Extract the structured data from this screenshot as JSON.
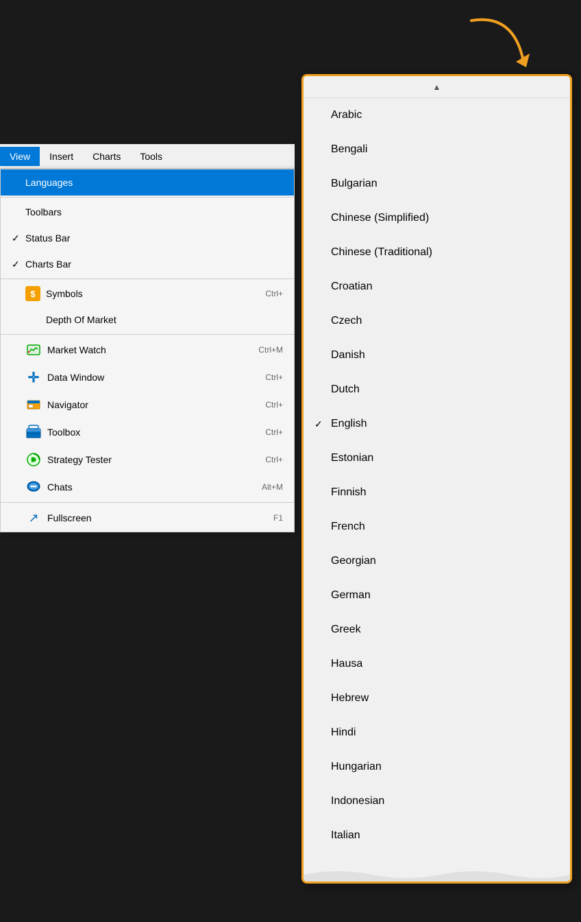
{
  "arrow": {
    "color": "#f0a020"
  },
  "menubar": {
    "items": [
      {
        "id": "view",
        "label": "View",
        "active": true
      },
      {
        "id": "insert",
        "label": "Insert",
        "active": false
      },
      {
        "id": "charts",
        "label": "Charts",
        "active": false
      },
      {
        "id": "tools",
        "label": "Tools",
        "active": false
      }
    ]
  },
  "dropdown": {
    "items": [
      {
        "id": "languages",
        "label": "Languages",
        "highlighted": true,
        "check": "",
        "icon": null,
        "shortcut": "",
        "hasIcon": false
      },
      {
        "id": "toolbars",
        "label": "Toolbars",
        "check": "",
        "icon": null,
        "shortcut": "",
        "hasIcon": false
      },
      {
        "id": "status-bar",
        "label": "Status Bar",
        "check": "✓",
        "icon": null,
        "shortcut": "",
        "hasIcon": false
      },
      {
        "id": "charts-bar",
        "label": "Charts Bar",
        "check": "✓",
        "icon": null,
        "shortcut": "",
        "hasIcon": false
      },
      {
        "id": "symbols",
        "label": "Symbols",
        "check": "",
        "icon": "$",
        "shortcut": "Ctrl+",
        "hasIcon": true,
        "iconType": "symbols"
      },
      {
        "id": "depth-of-market",
        "label": "Depth Of Market",
        "check": "",
        "icon": null,
        "shortcut": "",
        "hasIcon": false
      },
      {
        "id": "market-watch",
        "label": "Market Watch",
        "check": "",
        "icon": "📈",
        "shortcut": "Ctrl+M",
        "hasIcon": true,
        "iconType": "market-watch"
      },
      {
        "id": "data-window",
        "label": "Data Window",
        "check": "",
        "icon": "+",
        "shortcut": "Ctrl+",
        "hasIcon": true,
        "iconType": "data-window"
      },
      {
        "id": "navigator",
        "label": "Navigator",
        "check": "",
        "icon": "📁",
        "shortcut": "Ctrl+",
        "hasIcon": true,
        "iconType": "navigator"
      },
      {
        "id": "toolbox",
        "label": "Toolbox",
        "check": "",
        "icon": "🗃",
        "shortcut": "Ctrl+",
        "hasIcon": true,
        "iconType": "toolbox"
      },
      {
        "id": "strategy-tester",
        "label": "Strategy Tester",
        "check": "",
        "icon": "⚙",
        "shortcut": "Ctrl+",
        "hasIcon": true,
        "iconType": "strategy"
      },
      {
        "id": "chats",
        "label": "Chats",
        "check": "",
        "icon": "💬",
        "shortcut": "Alt+M",
        "hasIcon": true,
        "iconType": "chats"
      },
      {
        "id": "fullscreen",
        "label": "Fullscreen",
        "check": "",
        "icon": "↗",
        "shortcut": "F1",
        "hasIcon": true,
        "iconType": "fullscreen"
      }
    ]
  },
  "languages": {
    "scroll_up_label": "▲",
    "items": [
      {
        "id": "arabic",
        "label": "Arabic",
        "selected": false
      },
      {
        "id": "bengali",
        "label": "Bengali",
        "selected": false
      },
      {
        "id": "bulgarian",
        "label": "Bulgarian",
        "selected": false
      },
      {
        "id": "chinese-simplified",
        "label": "Chinese (Simplified)",
        "selected": false
      },
      {
        "id": "chinese-traditional",
        "label": "Chinese (Traditional)",
        "selected": false
      },
      {
        "id": "croatian",
        "label": "Croatian",
        "selected": false
      },
      {
        "id": "czech",
        "label": "Czech",
        "selected": false
      },
      {
        "id": "danish",
        "label": "Danish",
        "selected": false
      },
      {
        "id": "dutch",
        "label": "Dutch",
        "selected": false
      },
      {
        "id": "english",
        "label": "English",
        "selected": true
      },
      {
        "id": "estonian",
        "label": "Estonian",
        "selected": false
      },
      {
        "id": "finnish",
        "label": "Finnish",
        "selected": false
      },
      {
        "id": "french",
        "label": "French",
        "selected": false
      },
      {
        "id": "georgian",
        "label": "Georgian",
        "selected": false
      },
      {
        "id": "german",
        "label": "German",
        "selected": false
      },
      {
        "id": "greek",
        "label": "Greek",
        "selected": false
      },
      {
        "id": "hausa",
        "label": "Hausa",
        "selected": false
      },
      {
        "id": "hebrew",
        "label": "Hebrew",
        "selected": false
      },
      {
        "id": "hindi",
        "label": "Hindi",
        "selected": false
      },
      {
        "id": "hungarian",
        "label": "Hungarian",
        "selected": false
      },
      {
        "id": "indonesian",
        "label": "Indonesian",
        "selected": false
      },
      {
        "id": "italian",
        "label": "Italian",
        "selected": false
      }
    ]
  }
}
